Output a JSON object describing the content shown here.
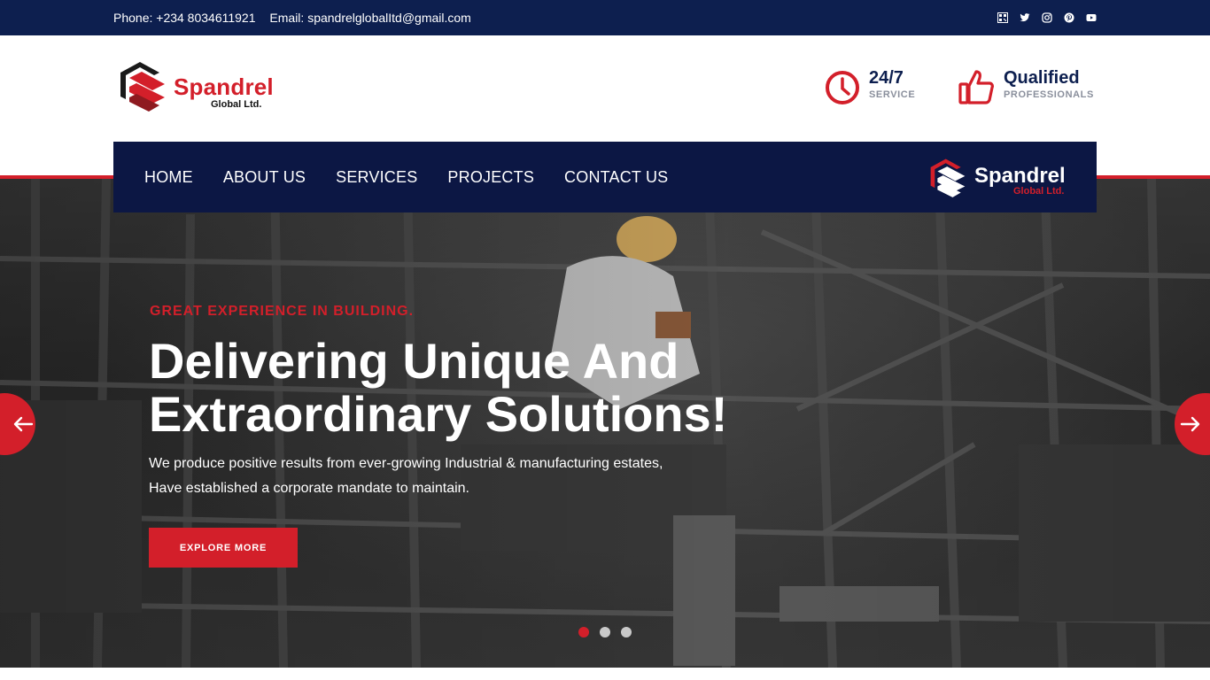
{
  "topbar": {
    "phone": "Phone: +234 8034611921",
    "email": "Email: spandrelglobalItd@gmail.com",
    "socials": [
      "qr-icon",
      "twitter-icon",
      "instagram-icon",
      "pinterest-icon",
      "youtube-icon"
    ]
  },
  "brand": {
    "name": "Spandrel",
    "sub": "Global Ltd."
  },
  "features": [
    {
      "title": "24/7",
      "subtitle": "SERVICE",
      "icon": "clock-icon"
    },
    {
      "title": "Qualified",
      "subtitle": "PROFESSIONALS",
      "icon": "thumbs-up-icon"
    }
  ],
  "nav": {
    "items": [
      "HOME",
      "ABOUT US",
      "SERVICES",
      "PROJECTS",
      "CONTACT US"
    ]
  },
  "hero": {
    "eyebrow": "GREAT EXPERIENCE IN BUILDING.",
    "headline_1": "Delivering Unique And",
    "headline_2": "Extraordinary Solutions!",
    "sub_1": "We produce positive results from ever-growing Industrial & manufacturing estates,",
    "sub_2": "Have established a corporate mandate to maintain.",
    "button": "EXPLORE MORE",
    "slides": 3,
    "active_slide": 1
  },
  "colors": {
    "navy": "#0d1f4f",
    "red": "#d31f2a"
  }
}
